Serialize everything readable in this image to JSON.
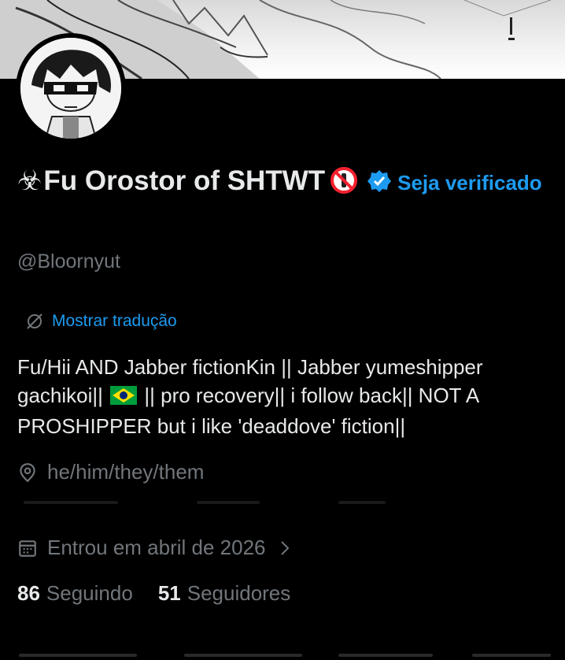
{
  "profile": {
    "name_prefix_symbol": "☣",
    "display_name": "Fu Orostor of SHTWT",
    "get_verified": "Seja verificado",
    "handle": "@Bloornyut",
    "translate_label": "Mostrar tradução",
    "bio_part1": "Fu/Hii AND Jabber fictionKin || Jabber yumeshipper gachikoi||",
    "bio_part2": "|| pro recovery|| i follow back|| NOT A PROSHIPPER but i like 'deaddove' fiction||",
    "location": "he/him/they/them",
    "joined": "Entrou em abril de 2026",
    "following_count": "86",
    "following_label": "Seguindo",
    "followers_count": "51",
    "followers_label": "Seguidores"
  },
  "icons": {
    "verified": "verified-badge-icon",
    "no_entry": "prohibited-icon",
    "flag": "brazil-flag-icon",
    "translate": "globe-slash-icon",
    "location": "location-pin-icon",
    "calendar": "calendar-icon",
    "chevron": "chevron-right-icon"
  },
  "colors": {
    "background": "#000000",
    "text_primary": "#e7e9ea",
    "text_secondary": "#71767b",
    "accent": "#1d9bf0",
    "verified": "#1d9bf0",
    "prohibited": "#f4212e"
  }
}
